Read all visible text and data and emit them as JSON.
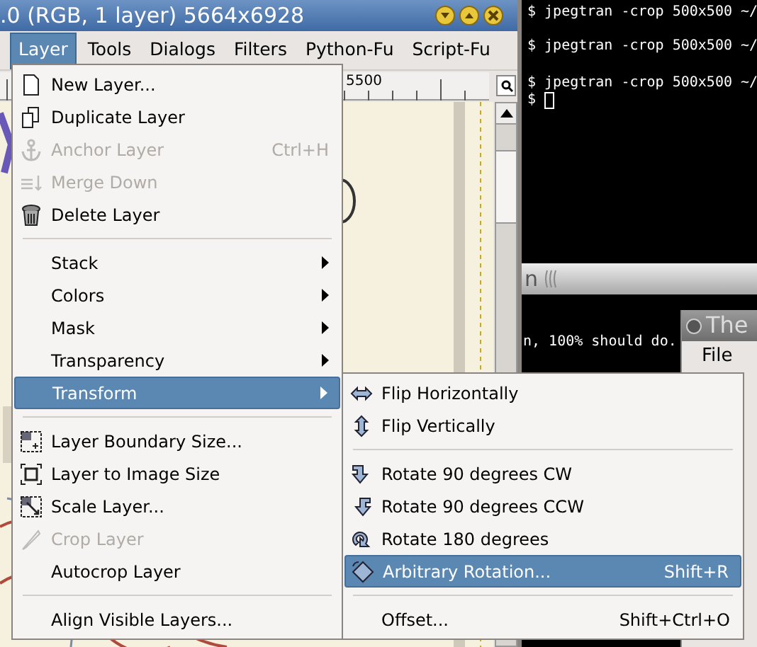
{
  "terminal": {
    "lines": [
      "$ jpegtran -crop 500x500 ~/",
      "$ jpegtran -crop 500x500 ~/",
      "$ jpegtran -crop 500x500 ~/",
      "$ "
    ]
  },
  "terminal_2": {
    "title": "n",
    "lines": [
      "n, 100% should do."
    ]
  },
  "third_window": {
    "title": "The",
    "menu": [
      "File"
    ]
  },
  "gimp_window": {
    "title": ".0 (RGB, 1 layer) 5664x6928",
    "ruler_label": "5500",
    "menubar": [
      {
        "label": "Layer",
        "selected": true
      },
      {
        "label": "Tools",
        "selected": false
      },
      {
        "label": "Dialogs",
        "selected": false
      },
      {
        "label": "Filters",
        "selected": false
      },
      {
        "label": "Python-Fu",
        "selected": false
      },
      {
        "label": "Script-Fu",
        "selected": false
      }
    ]
  },
  "layer_menu": {
    "items": [
      {
        "kind": "item",
        "label": "New Layer...",
        "disabled": false,
        "selected": false
      },
      {
        "kind": "item",
        "label": "Duplicate Layer",
        "disabled": false,
        "selected": false
      },
      {
        "kind": "item",
        "label": "Anchor Layer",
        "shortcut": "Ctrl+H",
        "disabled": true,
        "selected": false
      },
      {
        "kind": "item",
        "label": "Merge Down",
        "disabled": true,
        "selected": false
      },
      {
        "kind": "item",
        "label": "Delete Layer",
        "disabled": false,
        "selected": false
      },
      {
        "kind": "separator"
      },
      {
        "kind": "submenu",
        "label": "Stack",
        "disabled": false,
        "selected": false
      },
      {
        "kind": "submenu",
        "label": "Colors",
        "disabled": false,
        "selected": false
      },
      {
        "kind": "submenu",
        "label": "Mask",
        "disabled": false,
        "selected": false
      },
      {
        "kind": "submenu",
        "label": "Transparency",
        "disabled": false,
        "selected": false
      },
      {
        "kind": "submenu",
        "label": "Transform",
        "disabled": false,
        "selected": true
      },
      {
        "kind": "separator"
      },
      {
        "kind": "item",
        "label": "Layer Boundary Size...",
        "disabled": false,
        "selected": false
      },
      {
        "kind": "item",
        "label": "Layer to Image Size",
        "disabled": false,
        "selected": false
      },
      {
        "kind": "item",
        "label": "Scale Layer...",
        "disabled": false,
        "selected": false
      },
      {
        "kind": "item",
        "label": "Crop Layer",
        "disabled": true,
        "selected": false
      },
      {
        "kind": "item",
        "label": "Autocrop Layer",
        "disabled": false,
        "selected": false
      },
      {
        "kind": "separator"
      },
      {
        "kind": "item",
        "label": "Align Visible Layers...",
        "disabled": false,
        "selected": false
      }
    ]
  },
  "transform_menu": {
    "items": [
      {
        "kind": "item",
        "label": "Flip Horizontally",
        "disabled": false,
        "selected": false
      },
      {
        "kind": "item",
        "label": "Flip Vertically",
        "disabled": false,
        "selected": false
      },
      {
        "kind": "separator"
      },
      {
        "kind": "item",
        "label": "Rotate 90 degrees CW",
        "disabled": false,
        "selected": false
      },
      {
        "kind": "item",
        "label": "Rotate 90 degrees CCW",
        "disabled": false,
        "selected": false
      },
      {
        "kind": "item",
        "label": "Rotate 180 degrees",
        "disabled": false,
        "selected": false
      },
      {
        "kind": "item",
        "label": "Arbitrary Rotation...",
        "shortcut": "Shift+R",
        "disabled": false,
        "selected": true
      },
      {
        "kind": "separator"
      },
      {
        "kind": "item",
        "label": "Offset...",
        "shortcut": "Shift+Ctrl+O",
        "disabled": false,
        "selected": false
      }
    ]
  }
}
